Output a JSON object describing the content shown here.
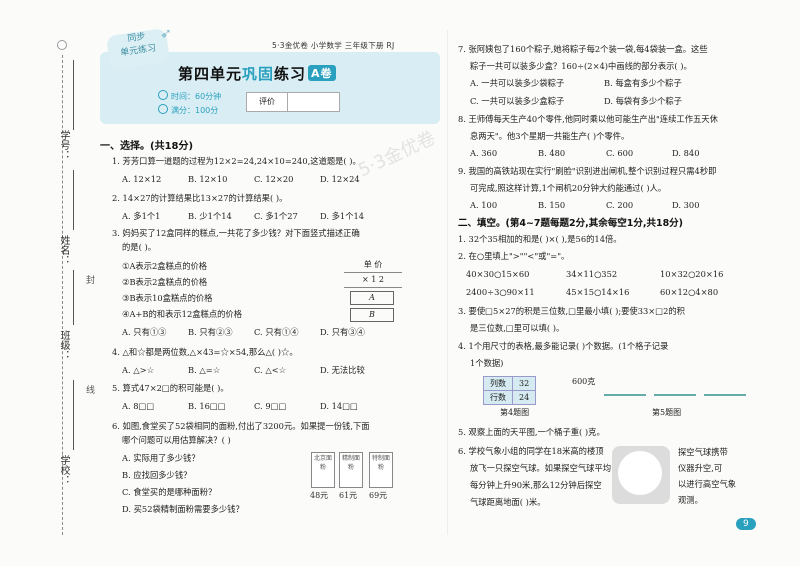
{
  "binding": {
    "student_id_label": "学号：",
    "name_label": "姓名：",
    "class_label": "班级：",
    "school_label": "学校：",
    "cut_words": [
      "封",
      "线"
    ]
  },
  "header": {
    "badge_line1": "同步",
    "badge_line2": "单元练习",
    "series": "5·3金优卷 小学数学 三年级下册 RJ",
    "title_prefix": "第四单元",
    "title_highlight": "巩固",
    "title_suffix": "练习",
    "title_tag": "A卷",
    "time": "时间：60分钟",
    "full_score": "满分：100分",
    "score_label": "评价"
  },
  "watermark": "5·3金优卷",
  "section1": {
    "heading": "一、选择。(共18分)",
    "q1": {
      "text": "1. 芳芳口算一道题的过程为12×2=24,24×10=240,这道题是(    )。",
      "options": [
        "A. 12×12",
        "B. 12×10",
        "C. 12×20",
        "D. 12×24"
      ]
    },
    "q2": {
      "text": "2. 14×27的计算结果比13×27的计算结果(    )。",
      "options": [
        "A. 多1个1",
        "B. 少1个14",
        "C. 多1个27",
        "D. 多1个14"
      ]
    },
    "q3": {
      "text1": "3. 妈妈买了12盒同样的糕点,一共花了多少钱？对下面竖式描述正确",
      "text2": "的是(    )。",
      "stmt1": "①A表示2盒糕点的价格",
      "stmt2": "②B表示2盒糕点的价格",
      "stmt3": "③B表示10盒糕点的价格",
      "stmt4": "④A+B的和表示12盒糕点的价格",
      "options": [
        "A. 只有①③",
        "B. 只有②③",
        "C. 只有①④",
        "D. 只有③④"
      ],
      "calc_top": "单  价",
      "calc_mul": "×  1  2",
      "calc_a": "A",
      "calc_b": "B"
    },
    "q4": {
      "text": "4. △和☆都是两位数,△×43=☆×54,那么△(    )☆。",
      "options": [
        "A. △>☆",
        "B. △=☆",
        "C. △<☆",
        "D. 无法比较"
      ]
    },
    "q5": {
      "text": "5. 算式47×2□的积可能是(    )。",
      "options": [
        "A. 8□□",
        "B. 16□□",
        "C. 9□□",
        "D. 14□□"
      ]
    },
    "q6": {
      "text1": "6. 如图,食堂买了52袋相同的面粉,付出了3200元。如果提一份钱,下面",
      "text2": "哪个问题可以用估算解决？(    )",
      "options": [
        "A. 实际用了多少钱？",
        "B. 应找回多少钱？",
        "C. 食堂买的是哪种面粉？",
        "D. 买52袋精制面粉需要多少钱？"
      ],
      "bags": [
        "北京面粉",
        "精制面粉",
        "特制面粉"
      ],
      "prices": [
        "48元",
        "61元",
        "69元"
      ]
    }
  },
  "right": {
    "q7": {
      "text1": "7. 张阿姨包了160个粽子,她将粽子每2个装一袋,每4袋装一盒。这些",
      "text2": "粽子一共可以装多少盒？160÷(2×4)中画线的部分表示(    )。",
      "options": [
        "A. 一共可以装多少袋粽子",
        "B. 每盒有多少个粽子",
        "C. 一共可以装多少盒粽子",
        "D. 每袋有多少个粽子"
      ]
    },
    "q8": {
      "text1": "8. 王师傅每天生产40个零件,他同时乘以他可能生产出\"连续工作五天休",
      "text2": "息两天\"。他3个星期一共能生产(    )个零件。",
      "options": [
        "A. 360",
        "B. 480",
        "C. 600",
        "D. 840"
      ]
    },
    "q9": {
      "text1": "9. 我国的高铁站现在实行\"刷脸\"识别进出闸机,整个识别过程只需4秒即",
      "text2": "可完成,照这样计算,1个闸机20分钟大约能通过(    )人。",
      "options": [
        "A. 100",
        "B. 150",
        "C. 200",
        "D. 300"
      ]
    },
    "section2_heading": "二、填空。(第4~7题每题2分,其余每空1分,共18分)",
    "f1": "1. 32个35相加的和是(    )×(    ),是56的14倍。",
    "f2": "2. 在○里填上\">\"\"<\"或\"=\"。",
    "f2_rows": [
      [
        "40×30○15×60",
        "34×11○352",
        "10×32○20×16"
      ],
      [
        "2400÷3○90×11",
        "45×15○14×16",
        "60×12○4×80"
      ]
    ],
    "f3a": "3. 要使□5×27的积是三位数,□里最小填(    );要使33×□2的积",
    "f3b": "是三位数,□里可以填(    )。",
    "f4a": "4. 1个用尺寸的表格,最多能记录(    )个数据。(1个格子记录",
    "f4b": "1个数据)",
    "table": {
      "rows_label": "列数",
      "rows_val": "32",
      "cols_label": "行数",
      "cols_val": "24"
    },
    "scale_weight": "600克",
    "cap4": "第4题图",
    "cap5": "第5题图",
    "f5": "5. 观察上面的天平图,一个桶子重(    )克。",
    "f6a": "6. 学校气象小组的同学在18米高的楼顶",
    "f6b": "放飞一只探空气球。如果探空气球平均",
    "f6c": "每分钟上升90米,那么12分钟后探空",
    "f6d": "气球距离地面(    )米。",
    "side_note": [
      "探空气球携带",
      "仪器升空,可",
      "以进行高空气象",
      "观测。"
    ],
    "page_number": "9"
  }
}
